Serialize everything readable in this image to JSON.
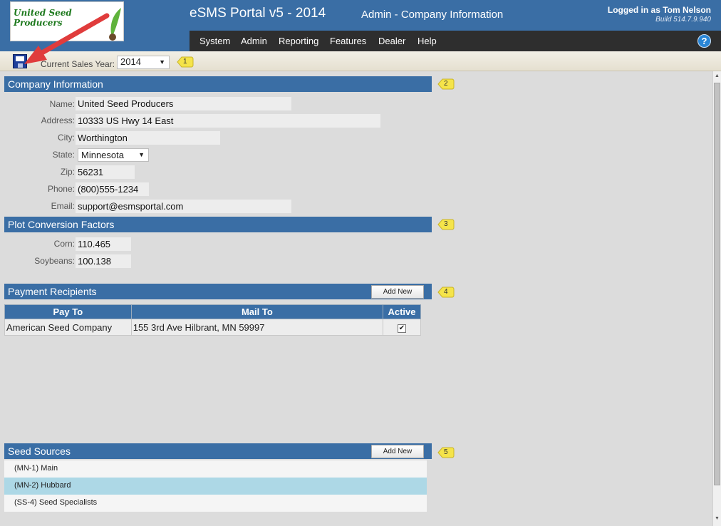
{
  "header": {
    "logo_text": "United Seed Producers",
    "app_title": "eSMS Portal v5 - 2014",
    "page_title": "Admin - Company Information",
    "logged_in": "Logged in as Tom Nelson",
    "build": "Build 514.7.9.940"
  },
  "menu": {
    "items": [
      "System",
      "Admin",
      "Reporting",
      "Features",
      "Dealer",
      "Help"
    ],
    "help_icon": "?"
  },
  "toolbar": {
    "sales_year_label": "Current Sales Year:",
    "sales_year_value": "2014"
  },
  "badges": [
    "1",
    "2",
    "3",
    "4",
    "5"
  ],
  "company": {
    "section_title": "Company Information",
    "name_label": "Name:",
    "name": "United Seed Producers",
    "address_label": "Address:",
    "address": "10333 US Hwy 14 East",
    "city_label": "City:",
    "city": "Worthington",
    "state_label": "State:",
    "state": "Minnesota",
    "zip_label": "Zip:",
    "zip": "56231",
    "phone_label": "Phone:",
    "phone": "(800)555-1234",
    "email_label": "Email:",
    "email": "support@esmsportal.com"
  },
  "plot": {
    "section_title": "Plot Conversion Factors",
    "corn_label": "Corn:",
    "corn": "110.465",
    "soybeans_label": "Soybeans:",
    "soybeans": "100.138"
  },
  "payment": {
    "section_title": "Payment Recipients",
    "add_new": "Add New",
    "columns": [
      "Pay To",
      "Mail To",
      "Active"
    ],
    "rows": [
      {
        "pay_to": "American Seed Company",
        "mail_to": "155 3rd Ave  Hilbrant, MN  59997",
        "active": "✔"
      }
    ]
  },
  "seed": {
    "section_title": "Seed Sources",
    "add_new": "Add New",
    "items": [
      "(MN-1) Main",
      "(MN-2) Hubbard",
      "(SS-4) Seed Specialists"
    ],
    "selected": "(MN-2) Hubbard"
  },
  "colors": {
    "accent": "#3a6ea5",
    "menubar": "#2e2e2e",
    "badge": "#f5e44a",
    "selected_row": "#add8e6",
    "annotation_arrow": "#e03c3c"
  }
}
